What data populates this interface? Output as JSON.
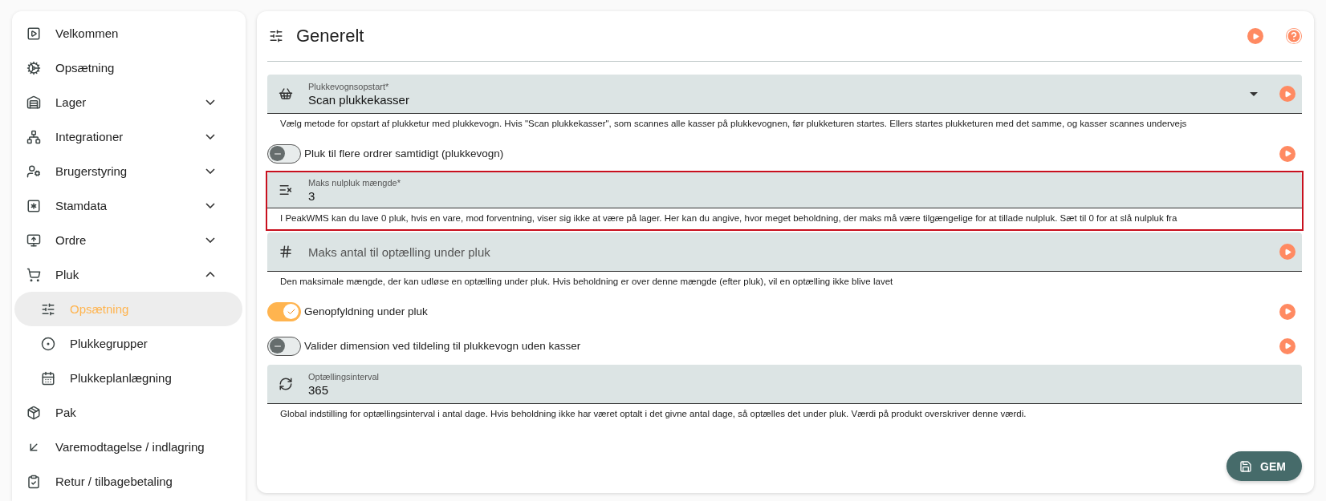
{
  "sidebar": {
    "items": [
      {
        "label": "Velkommen",
        "selected": false
      },
      {
        "label": "Opsætning",
        "selected": false
      },
      {
        "label": "Lager",
        "selected": false,
        "expanded": false
      },
      {
        "label": "Integrationer",
        "selected": false,
        "expanded": false
      },
      {
        "label": "Brugerstyring",
        "selected": false,
        "expanded": false
      },
      {
        "label": "Stamdata",
        "selected": false,
        "expanded": false
      },
      {
        "label": "Ordre",
        "selected": false,
        "expanded": false
      },
      {
        "label": "Pluk",
        "selected": false,
        "expanded": true,
        "children": [
          {
            "label": "Opsætning",
            "selected": true
          },
          {
            "label": "Plukkegrupper",
            "selected": false
          },
          {
            "label": "Plukkeplanlægning",
            "selected": false
          }
        ]
      },
      {
        "label": "Pak",
        "selected": false
      },
      {
        "label": "Varemodtagelse / indlagring",
        "selected": false
      },
      {
        "label": "Retur / tilbagebetaling",
        "selected": false
      }
    ]
  },
  "panel": {
    "title": "Generelt",
    "fields": [
      {
        "kind": "select",
        "label": "Plukkevognsopstart*",
        "value": "Scan plukkekasser",
        "error": false,
        "tour_button": true,
        "helper": "Vælg metode for opstart af plukketur med plukkevogn. Hvis \"Scan plukkekasser\", som scannes alle kasser på plukkevognen, før plukketuren startes. Ellers startes plukketuren med det samme, og kasser scannes undervejs"
      },
      {
        "kind": "switch",
        "label": "Pluk til flere ordrer samtidigt (plukkevogn)",
        "on": false,
        "tour_button": true
      },
      {
        "kind": "text",
        "label": "Maks nulpluk mængde*",
        "value": "3",
        "error": true,
        "tour_button": false,
        "helper": "I PeakWMS kan du lave 0 pluk, hvis en vare, mod forventning, viser sig ikke at være på lager. Her kan du angive, hvor meget beholdning, der maks må være tilgængelige for at tillade nulpluk. Sæt til 0 for at slå nulpluk fra"
      },
      {
        "kind": "text",
        "placeholder": "Maks antal til optælling under pluk",
        "error": false,
        "tour_button": true,
        "helper": "Den maksimale mængde, der kan udløse en optælling under pluk. Hvis beholdning er over denne mængde (efter pluk), vil en optælling ikke blive lavet"
      },
      {
        "kind": "switch",
        "label": "Genopfyldning under pluk",
        "on": true,
        "tour_button": true
      },
      {
        "kind": "switch",
        "label": "Valider dimension ved tildeling til plukkevogn uden kasser",
        "on": false,
        "tour_button": true
      },
      {
        "kind": "text",
        "label": "Optællingsinterval",
        "value": "365",
        "error": false,
        "tour_button": false,
        "helper": "Global indstilling for optællingsinterval i antal dage. Hvis beholdning ikke har været optalt i det givne antal dage, så optælles det under pluk. Værdi på produkt overskriver denne værdi."
      }
    ],
    "save_button": "GEM"
  }
}
